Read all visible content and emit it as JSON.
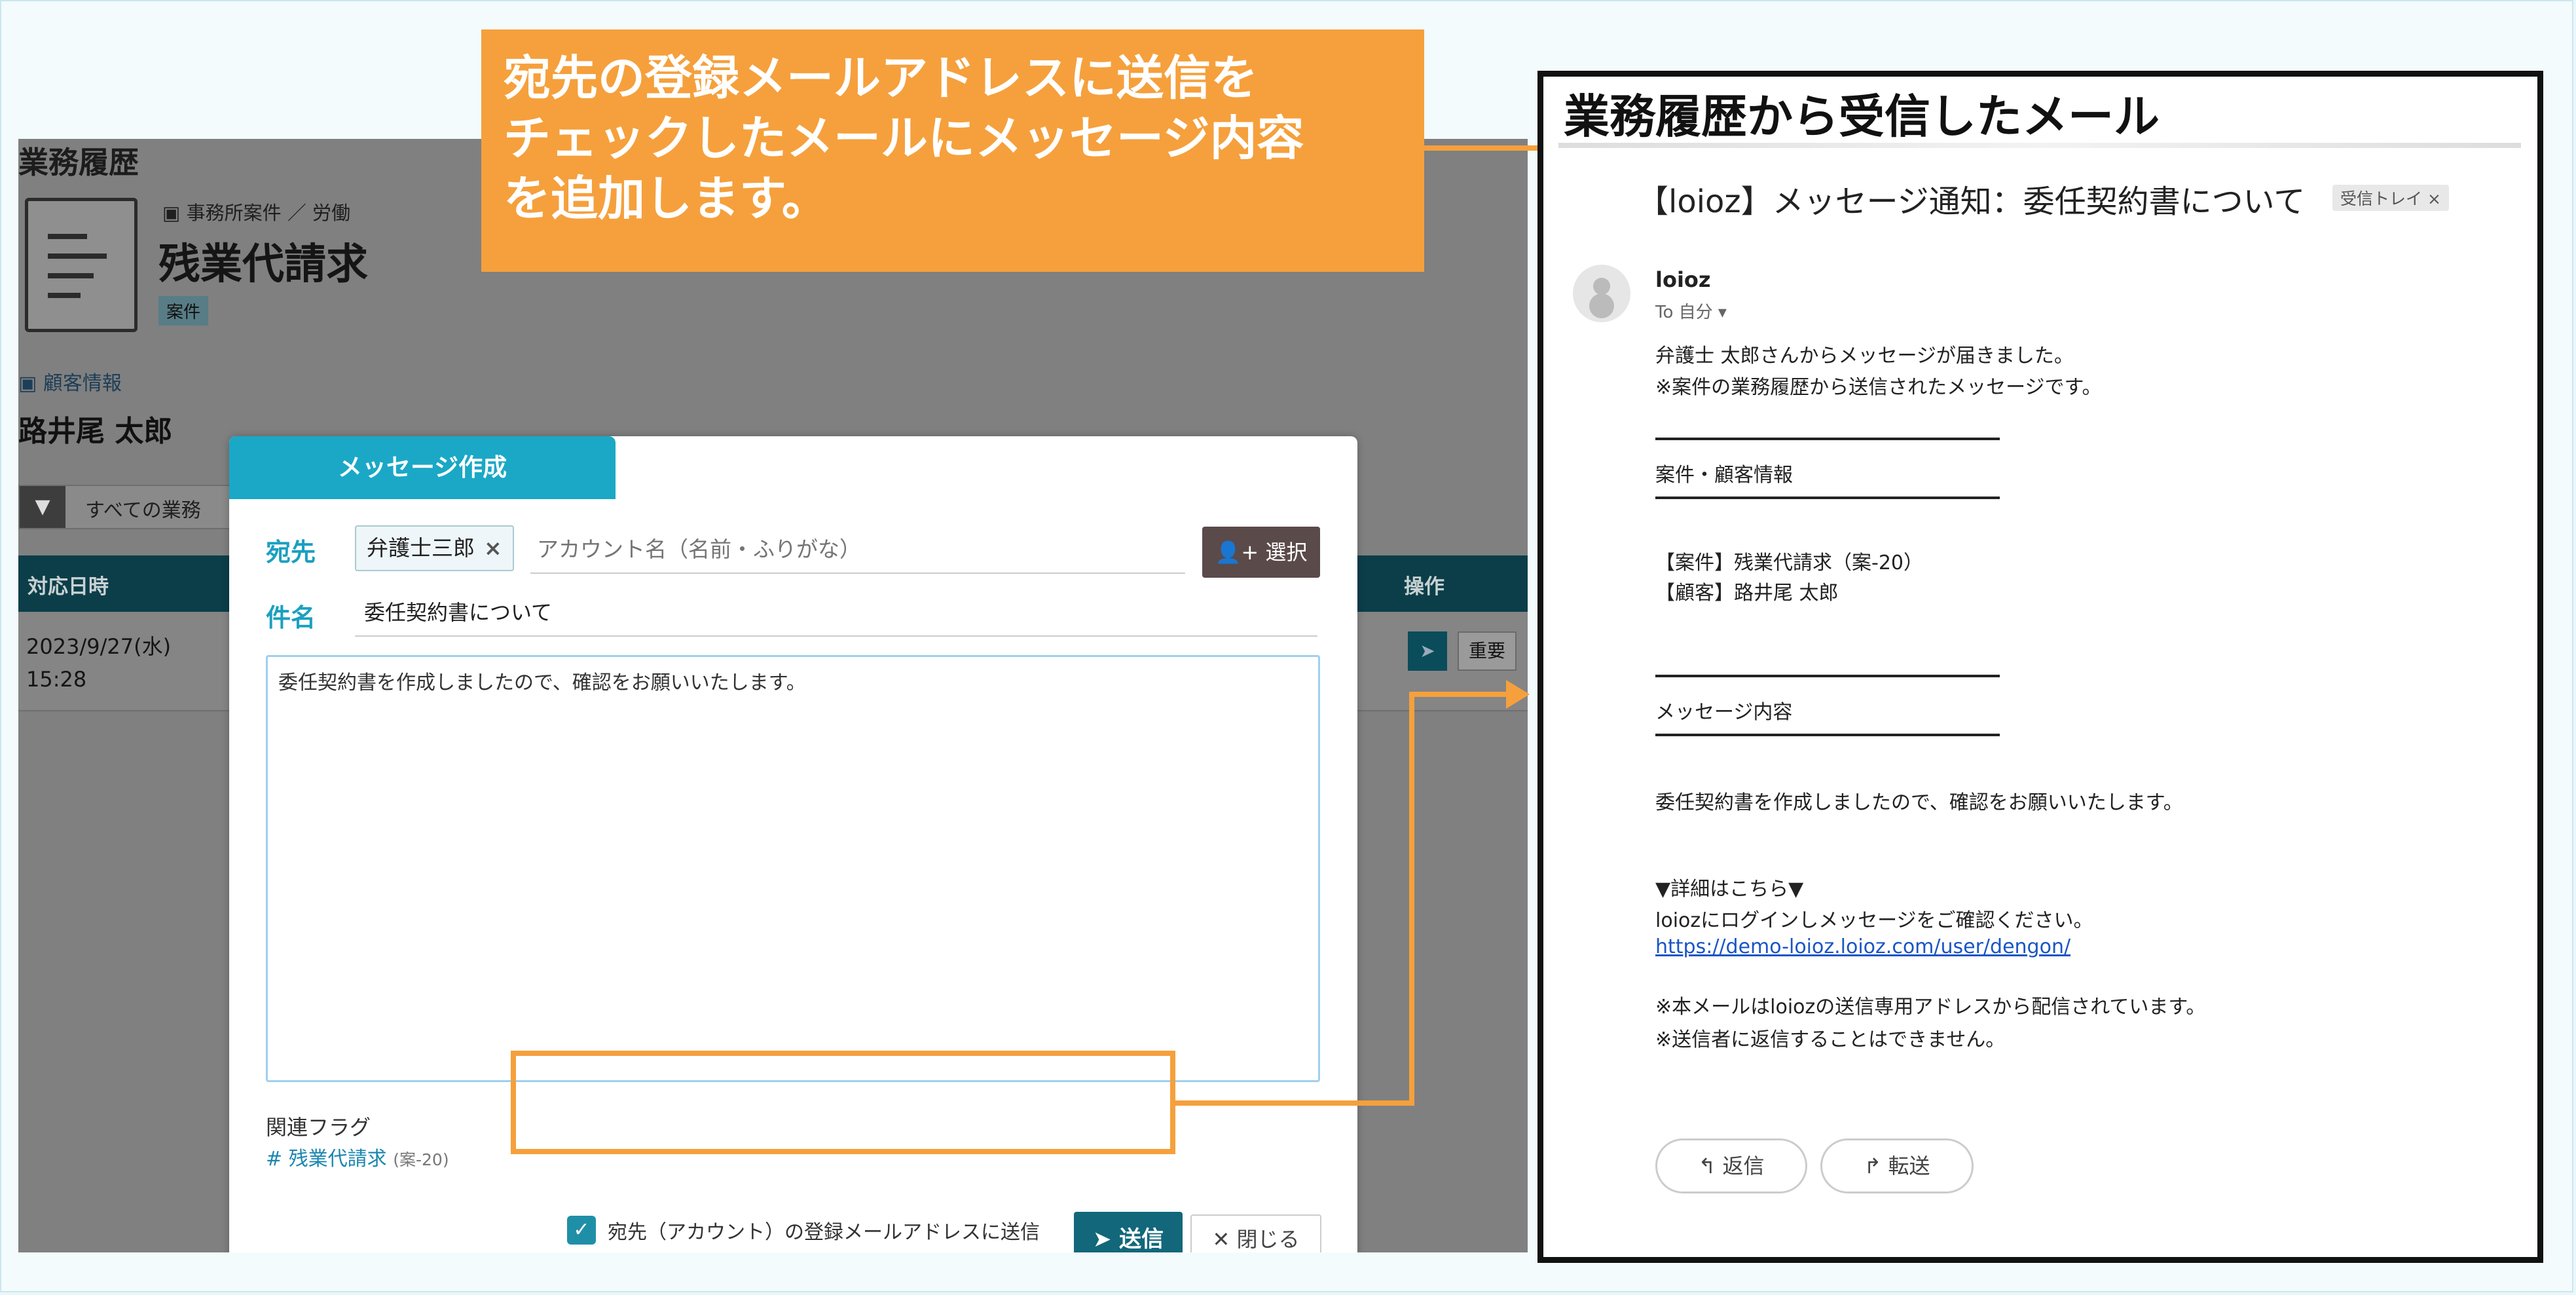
{
  "callout": {
    "lines": [
      "宛先の登録メールアドレスに送信を",
      "チェックしたメールにメッセージ内容",
      "を追加します。"
    ]
  },
  "background": {
    "section_title": "業務履歴",
    "breadcrumb": "事務所案件 ／ 労働",
    "case_title": "残業代請求",
    "case_tag": "案件",
    "customer_link": "顧客情報",
    "customer_name": "路井尾 太郎",
    "filter_text": "すべての業務",
    "table": {
      "col_datetime": "対応日時",
      "col_actions": "操作",
      "row_date": "2023/9/27(水)",
      "row_time": "15:28",
      "important_label": "重要"
    }
  },
  "modal": {
    "tab_title": "メッセージ作成",
    "to_label": "宛先",
    "recipient_chip": "弁護士三郎",
    "recipient_placeholder": "アカウント名（名前・ふりがな）",
    "select_button": "選択",
    "subject_label": "件名",
    "subject_value": "委任契約書について",
    "body_value": "委任契約書を作成しましたので、確認をお願いいたします。",
    "related_flag_title": "関連フラグ",
    "related_flag_link": "残業代請求",
    "related_flag_code": "(案-20)",
    "send_to_email_checkbox": "宛先（アカウント）の登録メールアドレスに送信",
    "send_button": "送信",
    "close_button": "閉じる"
  },
  "email_panel": {
    "title": "業務履歴から受信したメール",
    "subject": "【loioz】メッセージ通知：委任契約書について",
    "badge": "受信トレイ ×",
    "from": "loioz",
    "to": "To 自分 ▾",
    "intro_line1": "弁護士 太郎さんからメッセージが届きました。",
    "intro_line2": "※案件の業務履歴から送信されたメッセージです。",
    "case_info_heading": "案件・顧客情報",
    "case_line": "【案件】残業代請求（案-20）",
    "customer_line": "【顧客】路井尾 太郎",
    "message_heading": "メッセージ内容",
    "message_body": "委任契約書を作成しましたので、確認をお願いいたします。",
    "details_heading": "▼詳細はこちら▼",
    "login_text": "loiozにログインしメッセージをご確認ください。",
    "link": "https://demo-loioz.loioz.com/user/dengon/",
    "footer_line1": "※本メールはloiozの送信専用アドレスから配信されています。",
    "footer_line2": "※送信者に返信することはできません。",
    "reply_button": "返信",
    "forward_button": "転送"
  },
  "colors": {
    "accent_orange": "#f5a03c",
    "modal_tab": "#1aa8c6",
    "send_button": "#12677b",
    "link_blue": "#1a55c5"
  }
}
